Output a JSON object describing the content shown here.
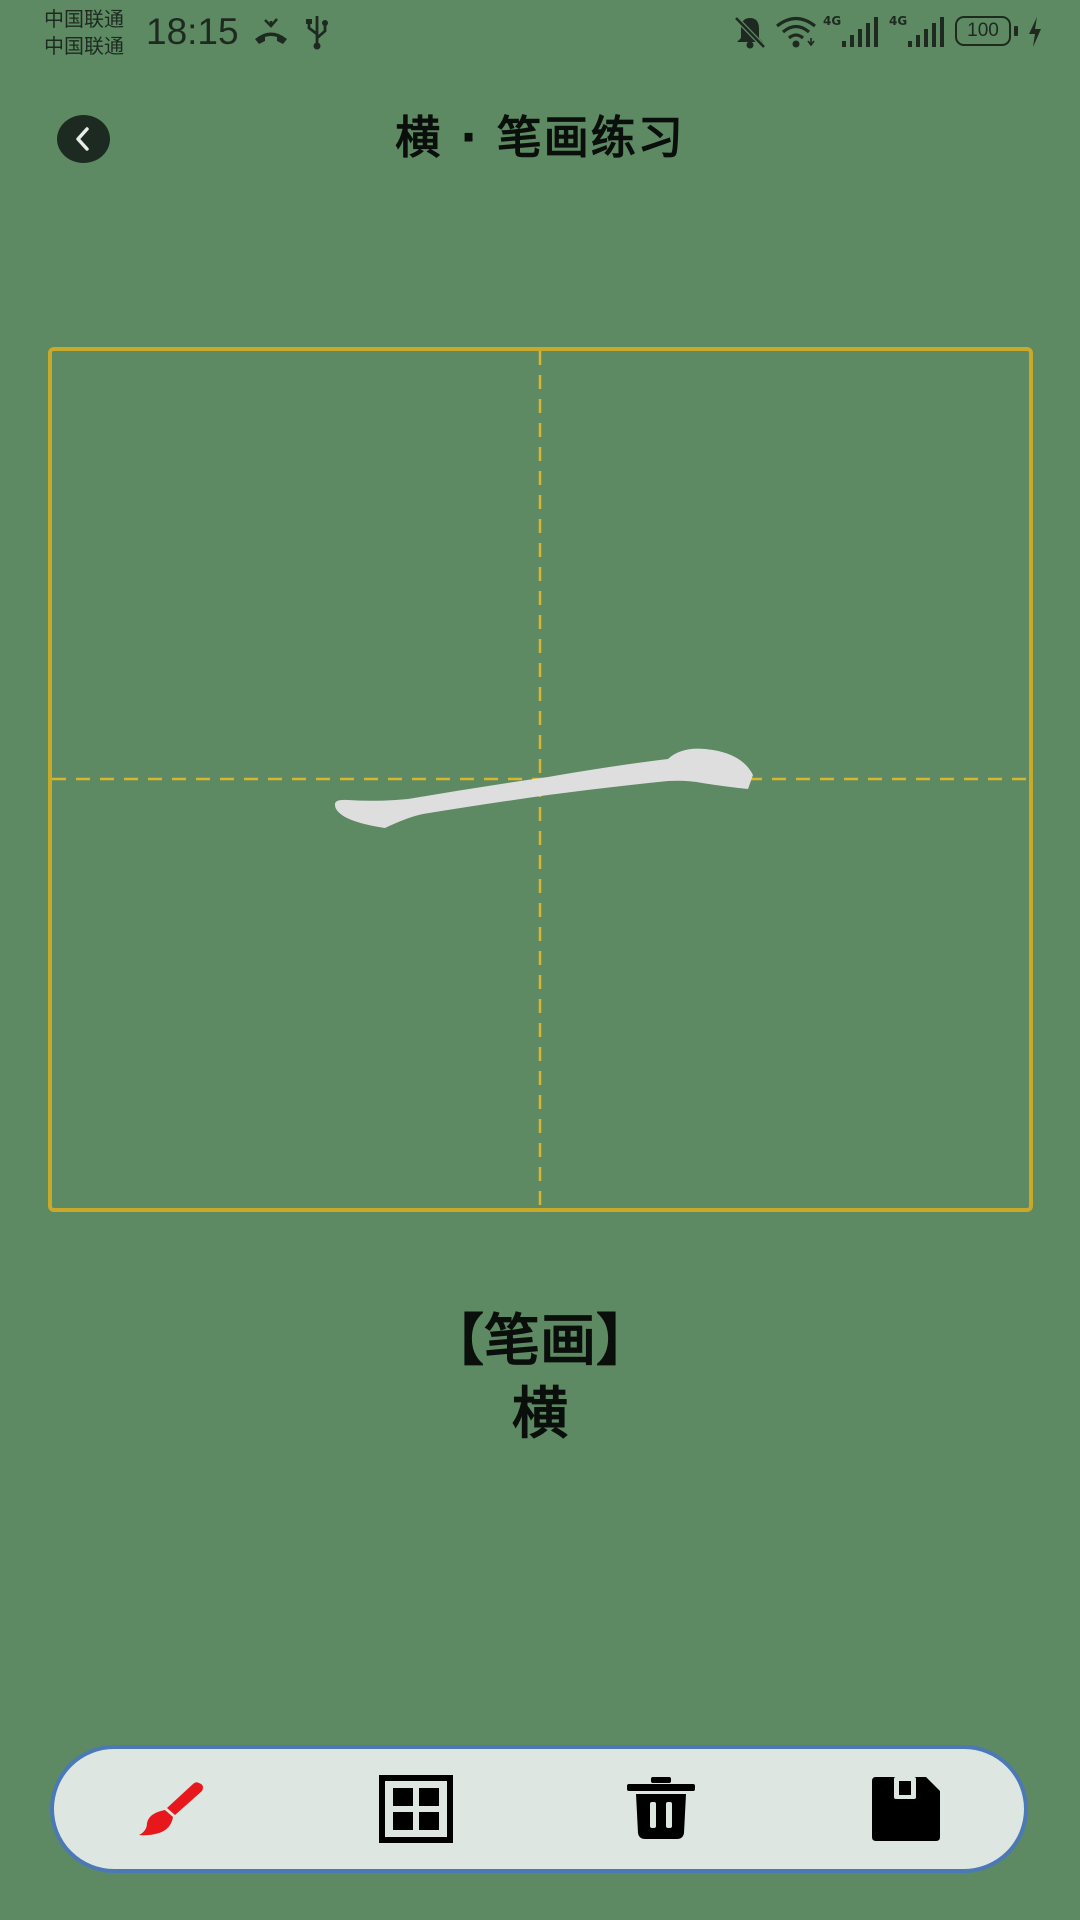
{
  "status_bar": {
    "carrier_1": "中国联通",
    "carrier_2": "中国联通",
    "time": "18:15",
    "network_1": "4G",
    "network_2": "4G",
    "battery": "100",
    "icons": [
      "missed-call-icon",
      "usb-icon",
      "mute-bell-icon",
      "wifi-icon",
      "signal-icon",
      "battery-icon",
      "charging-icon"
    ]
  },
  "header": {
    "title": "横 · 笔画练习",
    "back_icon": "chevron-left-icon"
  },
  "grid": {
    "border_color": "#c9a92a",
    "guide_color": "#d8b52c",
    "stroke_color": "#dedede"
  },
  "stroke_info": {
    "heading": "【笔画】",
    "name": "横"
  },
  "toolbar": {
    "tools": [
      {
        "name": "brush",
        "icon": "paint-brush-icon",
        "color": "#e8171b"
      },
      {
        "name": "grid",
        "icon": "grid-icon",
        "color": "#000000"
      },
      {
        "name": "clear",
        "icon": "trash-icon",
        "color": "#000000"
      },
      {
        "name": "save",
        "icon": "floppy-disk-icon",
        "color": "#000000"
      }
    ],
    "border_color": "#4b79b6",
    "background": "#dde6e0"
  }
}
